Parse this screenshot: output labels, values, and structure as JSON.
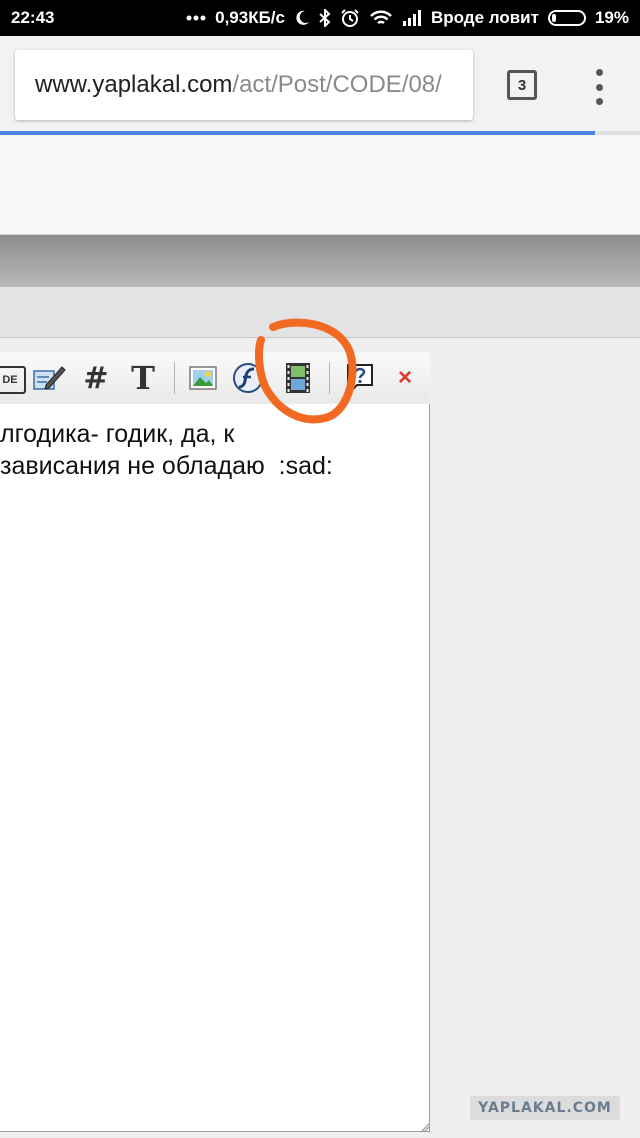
{
  "status_bar": {
    "time": "22:43",
    "speed": "0,93КБ/с",
    "carrier": "Вроде ловит",
    "battery": "19%",
    "icons": [
      "signal-dots-icon",
      "moon-icon",
      "bluetooth-icon",
      "alarm-icon",
      "wifi-icon",
      "cell-signal-icon",
      "battery-icon"
    ]
  },
  "browser": {
    "url_host": "www.yaplakal.com",
    "url_path": "/act/Post/CODE/08/",
    "tab_count": "3",
    "load_progress": 0.93,
    "accent_color": "#4a86e8"
  },
  "editor": {
    "toolbar": {
      "code_label": "DE",
      "hash_label": "#",
      "text_label": "T",
      "close_label": "×",
      "icons": [
        "code-icon",
        "edit-icon",
        "hash-icon",
        "text-icon",
        "image-icon",
        "flash-icon",
        "video-icon",
        "help-icon",
        "close-icon"
      ]
    },
    "text": "лгодика- годик, да, к\nзависания не обладаю  :sad:"
  },
  "annotation_color": "#f26a21",
  "watermark": "YAPLAKAL.COM"
}
